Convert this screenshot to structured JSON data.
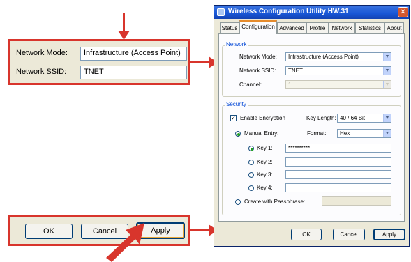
{
  "colors": {
    "annotation_red": "#d8352c",
    "window_blue": "#1856d6",
    "dialog_bg": "#ece9d8"
  },
  "zoom_top": {
    "network_mode_label": "Network Mode:",
    "network_mode_value": "Infrastructure (Access Point)",
    "network_ssid_label": "Network SSID:",
    "network_ssid_value": "TNET"
  },
  "zoom_bottom": {
    "ok": "OK",
    "cancel": "Cancel",
    "apply": "Apply"
  },
  "dialog": {
    "title": "Wireless Configuration Utility HW.31",
    "close_glyph": "✕",
    "tabs": [
      "Status",
      "Configuration",
      "Advanced",
      "Profile",
      "Network",
      "Statistics",
      "About"
    ],
    "selected_tab": "Configuration",
    "network": {
      "group_label": "Network",
      "mode_label": "Network Mode:",
      "mode_value": "Infrastructure (Access Point)",
      "ssid_label": "Network SSID:",
      "ssid_value": "TNET",
      "channel_label": "Channel:",
      "channel_value": "1"
    },
    "security": {
      "group_label": "Security",
      "enable_encryption_label": "Enable Encryption",
      "enable_encryption_checked": true,
      "key_length_label": "Key Length:",
      "key_length_value": "40 / 64 Bit",
      "manual_entry_label": "Manual Entry:",
      "format_label": "Format:",
      "format_value": "Hex",
      "key1_label": "Key 1:",
      "key1_value": "**********",
      "key2_label": "Key 2:",
      "key3_label": "Key 3:",
      "key4_label": "Key 4:",
      "passphrase_label": "Create with Passphrase:"
    },
    "buttons": {
      "ok": "OK",
      "cancel": "Cancel",
      "apply": "Apply"
    }
  }
}
